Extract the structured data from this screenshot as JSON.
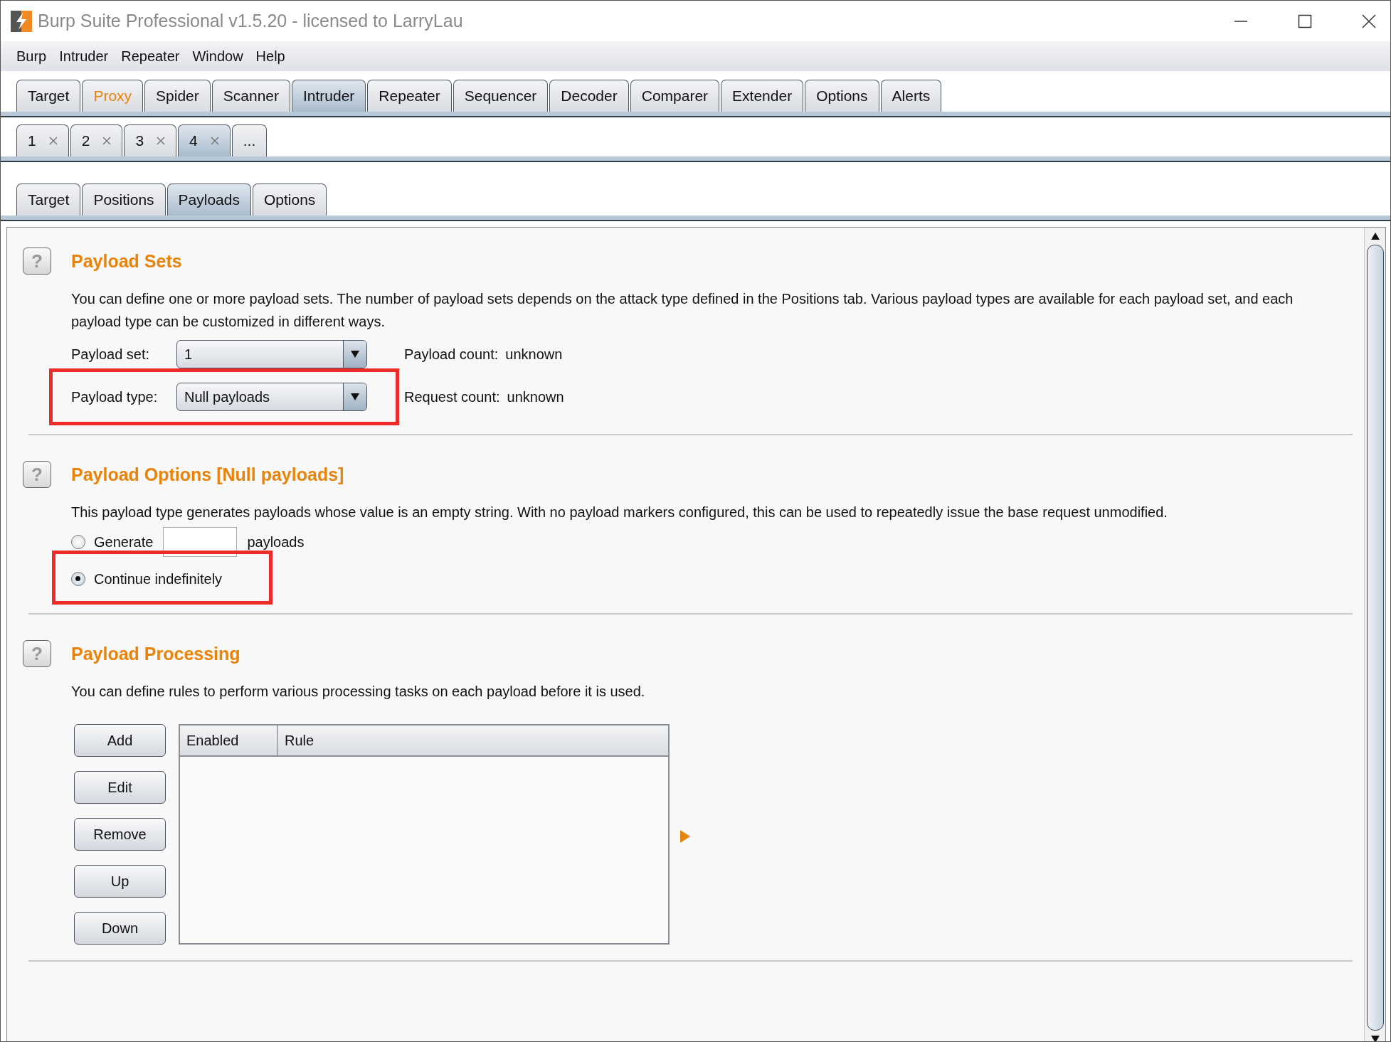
{
  "window": {
    "title": "Burp Suite Professional v1.5.20 - licensed to LarryLau"
  },
  "menu": [
    "Burp",
    "Intruder",
    "Repeater",
    "Window",
    "Help"
  ],
  "main_tabs": [
    {
      "label": "Target",
      "selected": false,
      "highlighted": false
    },
    {
      "label": "Proxy",
      "selected": false,
      "highlighted": true
    },
    {
      "label": "Spider",
      "selected": false,
      "highlighted": false
    },
    {
      "label": "Scanner",
      "selected": false,
      "highlighted": false
    },
    {
      "label": "Intruder",
      "selected": true,
      "highlighted": false
    },
    {
      "label": "Repeater",
      "selected": false,
      "highlighted": false
    },
    {
      "label": "Sequencer",
      "selected": false,
      "highlighted": false
    },
    {
      "label": "Decoder",
      "selected": false,
      "highlighted": false
    },
    {
      "label": "Comparer",
      "selected": false,
      "highlighted": false
    },
    {
      "label": "Extender",
      "selected": false,
      "highlighted": false
    },
    {
      "label": "Options",
      "selected": false,
      "highlighted": false
    },
    {
      "label": "Alerts",
      "selected": false,
      "highlighted": false
    }
  ],
  "attack_tabs": [
    {
      "label": "1",
      "selected": false,
      "closable": true
    },
    {
      "label": "2",
      "selected": false,
      "closable": true
    },
    {
      "label": "3",
      "selected": false,
      "closable": true
    },
    {
      "label": "4",
      "selected": true,
      "closable": true
    },
    {
      "label": "...",
      "selected": false,
      "closable": false
    }
  ],
  "intruder_tabs": [
    {
      "label": "Target",
      "selected": false
    },
    {
      "label": "Positions",
      "selected": false
    },
    {
      "label": "Payloads",
      "selected": true
    },
    {
      "label": "Options",
      "selected": false
    }
  ],
  "payload_sets": {
    "help": "?",
    "title": "Payload Sets",
    "description": "You can define one or more payload sets. The number of payload sets depends on the attack type defined in the Positions tab. Various payload types are available for each payload set, and each payload type can be customized in different ways.",
    "rows": [
      {
        "label": "Payload set:",
        "value": "1",
        "info_label": "Payload count:",
        "info_value": "unknown",
        "highlighted": false
      },
      {
        "label": "Payload type:",
        "value": "Null payloads",
        "info_label": "Request count:",
        "info_value": "unknown",
        "highlighted": true
      }
    ]
  },
  "payload_options": {
    "help": "?",
    "title": "Payload Options [Null payloads]",
    "description": "This payload type generates payloads whose value is an empty string. With no payload markers configured, this can be used to repeatedly issue the base request unmodified.",
    "options": [
      {
        "kind": "count",
        "label": "Generate",
        "suffix": "payloads",
        "selected": false,
        "highlighted": false
      },
      {
        "kind": "plain",
        "label": "Continue indefinitely",
        "selected": true,
        "highlighted": true
      }
    ]
  },
  "payload_processing": {
    "help": "?",
    "title": "Payload Processing",
    "description": "You can define rules to perform various processing tasks on each payload before it is used.",
    "buttons": [
      "Add",
      "Edit",
      "Remove",
      "Up",
      "Down"
    ],
    "table": {
      "columns": [
        "Enabled",
        "Rule"
      ]
    }
  }
}
